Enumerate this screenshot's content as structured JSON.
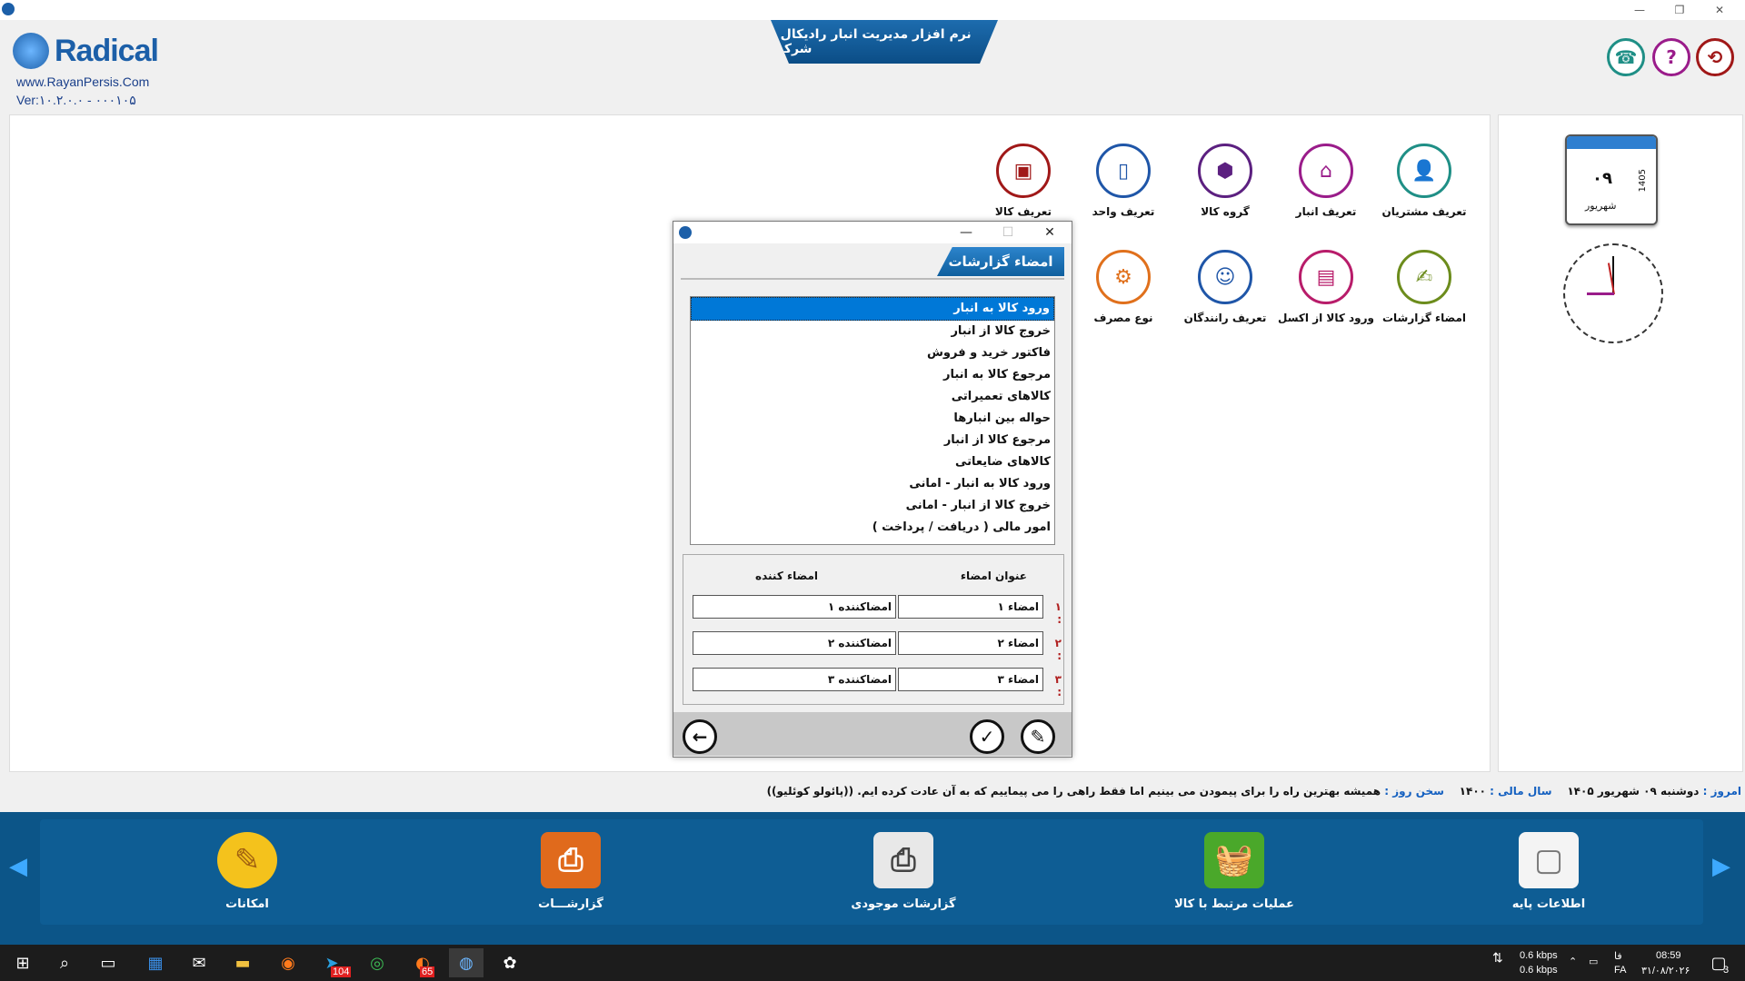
{
  "window": {
    "title_banner": "نرم افزار مدیریت انبار رادیکال - شرکت",
    "minimize": "—",
    "maximize": "❐",
    "close": "✕"
  },
  "brand": {
    "logo": "Radical",
    "website": "www.RayanPersis.Com",
    "version": "Ver:۱۰.۲.۰.۰ - ۰۰۰۱۰۵"
  },
  "shortcuts_row1": [
    {
      "label": "تعریف مشتریان",
      "icon": "customer-icon",
      "color": "#1f8f86"
    },
    {
      "label": "تعریف انبار",
      "icon": "warehouse-icon",
      "color": "#9a1c8a"
    },
    {
      "label": "گروه کالا",
      "icon": "product-group-icon",
      "color": "#5c2080"
    },
    {
      "label": "تعریف واحد",
      "icon": "unit-icon",
      "color": "#1f56a8"
    },
    {
      "label": "تعریف کالا",
      "icon": "product-icon",
      "color": "#a01818"
    }
  ],
  "shortcuts_row2": [
    {
      "label": "امضاء گزارشات",
      "icon": "report-signature-icon",
      "color": "#6c8c1c"
    },
    {
      "label": "ورود کالا از اکسل",
      "icon": "excel-import-icon",
      "color": "#b81c6a"
    },
    {
      "label": "تعریف رانندگان",
      "icon": "driver-icon",
      "color": "#1f56a8"
    },
    {
      "label": "نوع مصرف",
      "icon": "consumption-type-icon",
      "color": "#e0701c"
    }
  ],
  "calendar": {
    "day": "۰۹",
    "month": "شهریور",
    "year": "1405"
  },
  "status": {
    "today_label": "امروز :",
    "today_value": "دوشنبه ۰۹ شهریور ۱۴۰۵",
    "fiscal_label": "سال مالی :",
    "fiscal_value": "۱۴۰۰",
    "quote_label": "سخن روز :",
    "quote_value": "همیشه بهترین راه را برای پیمودن می بینیم اما فقط راهی را می پیماییم که به آن عادت کرده ایم. ((پائولو کوئلیو))"
  },
  "bottom_tools": [
    {
      "label": "اطلاعات پایه",
      "icon": "base-info-icon"
    },
    {
      "label": "عملیات مرتبط با کالا",
      "icon": "basket-icon"
    },
    {
      "label": "گزارشات موجودی",
      "icon": "inventory-report-icon"
    },
    {
      "label": "گزارشـــات",
      "icon": "reports-icon"
    },
    {
      "label": "امکانات",
      "icon": "tools-icon"
    }
  ],
  "dialog": {
    "title": "امضاء گزارشات",
    "reports": [
      "ورود کالا به انبار",
      "خروج کالا از انبار",
      "فاکتور خرید و فروش",
      "مرجوع کالا به انبار",
      "کالاهای تعمیراتی",
      "حواله بین انبارها",
      "مرجوع کالا از انبار",
      "کالاهای ضایعاتی",
      "ورود کالا به انبار - امانی",
      "خروج کالا از انبار - امانی",
      "امور مالی ( دریافت / پرداخت )"
    ],
    "selected_index": 0,
    "col_title": "عنوان امضاء",
    "col_signer": "امضاء کننده",
    "rows": [
      {
        "num": "۱ :",
        "title": "امضاء ۱",
        "signer": "امضاکننده ۱"
      },
      {
        "num": "۲ :",
        "title": "امضاء ۲",
        "signer": "امضاکننده ۲"
      },
      {
        "num": "۳ :",
        "title": "امضاء ۳",
        "signer": "امضاکننده ۳"
      }
    ]
  },
  "taskbar": {
    "net_down": "0.6 kbps",
    "net_up": "0.6 kbps",
    "lang1": "فا",
    "lang2": "FA",
    "time": "08:59",
    "date": "۳۱/۰۸/۲۰۲۶",
    "telegram_badge": "104",
    "app_badge": "65",
    "notif_count": "3"
  }
}
